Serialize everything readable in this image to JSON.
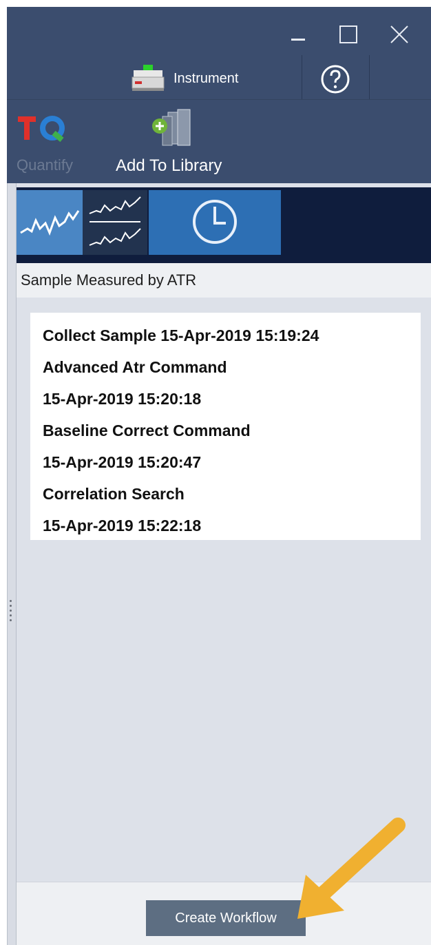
{
  "window": {
    "controls": {
      "minimize_icon": "minimize-icon",
      "maximize_icon": "maximize-icon",
      "close_icon": "close-icon"
    }
  },
  "header": {
    "instrument_label": "Instrument",
    "help_icon": "help-icon"
  },
  "ribbon": {
    "quantify_label": "Quantify",
    "add_to_library_label": "Add To Library"
  },
  "view_modes": [
    {
      "icon": "single-spectrum-icon",
      "active": true
    },
    {
      "icon": "stacked-spectra-icon",
      "active": false
    },
    {
      "icon": "history-clock-icon",
      "active": false
    }
  ],
  "sample": {
    "title": "Sample Measured by ATR",
    "history_lines": [
      "Collect Sample  15-Apr-2019 15:19:24",
      "Advanced Atr Command",
      "15-Apr-2019 15:20:18",
      "Baseline Correct Command",
      "15-Apr-2019 15:20:47",
      "Correlation Search",
      "15-Apr-2019 15:22:18"
    ]
  },
  "footer": {
    "create_workflow_label": "Create Workflow"
  },
  "colors": {
    "header_bg": "#3b4d6e",
    "viewbar_bg": "#0f1d3d",
    "active_view": "#4a86c4",
    "panel_bg": "#dde1e9",
    "button_bg": "#5d6e82",
    "annotation_arrow": "#f0b030"
  }
}
